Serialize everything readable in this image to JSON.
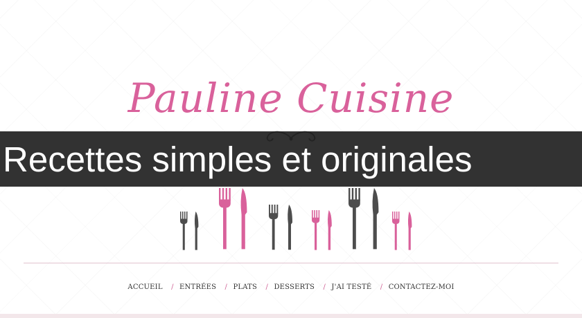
{
  "site": {
    "title": "Pauline Cuisine",
    "banner": "Recettes simples et originales"
  },
  "nav": {
    "items": [
      "ACCUEIL",
      "ENTRÉES",
      "PLATS",
      "DESSERTS",
      "J'AI TESTÉ",
      "CONTACTEZ-MOI"
    ],
    "separator": "/"
  },
  "colors": {
    "brand_pink": "#d9619b",
    "cutlery_gray": "#4d4d4d",
    "banner_bg": "#222222",
    "divider": "#e1c2cf"
  },
  "icons": [
    "ornament-flourish-icon",
    "fork-icon",
    "knife-icon"
  ]
}
